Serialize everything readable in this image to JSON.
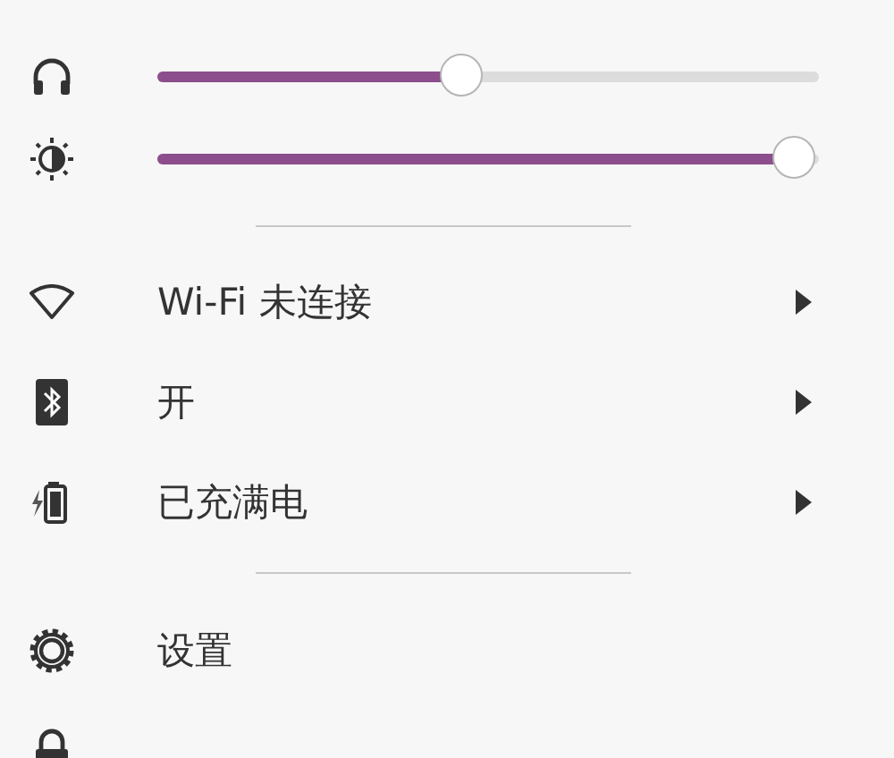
{
  "sliders": [
    {
      "kind": "volume",
      "level": 0.46
    },
    {
      "kind": "brightness",
      "level": 1.0
    }
  ],
  "menu_sections": [
    [
      {
        "kind": "wifi",
        "label": "Wi-Fi 未连接",
        "submenu": true
      },
      {
        "kind": "bluetooth",
        "label": "开",
        "submenu": true
      },
      {
        "kind": "battery",
        "label": "已充满电",
        "submenu": true
      }
    ],
    [
      {
        "kind": "settings",
        "label": "设置",
        "submenu": false
      },
      {
        "kind": "lock",
        "submenu": false
      }
    ]
  ]
}
